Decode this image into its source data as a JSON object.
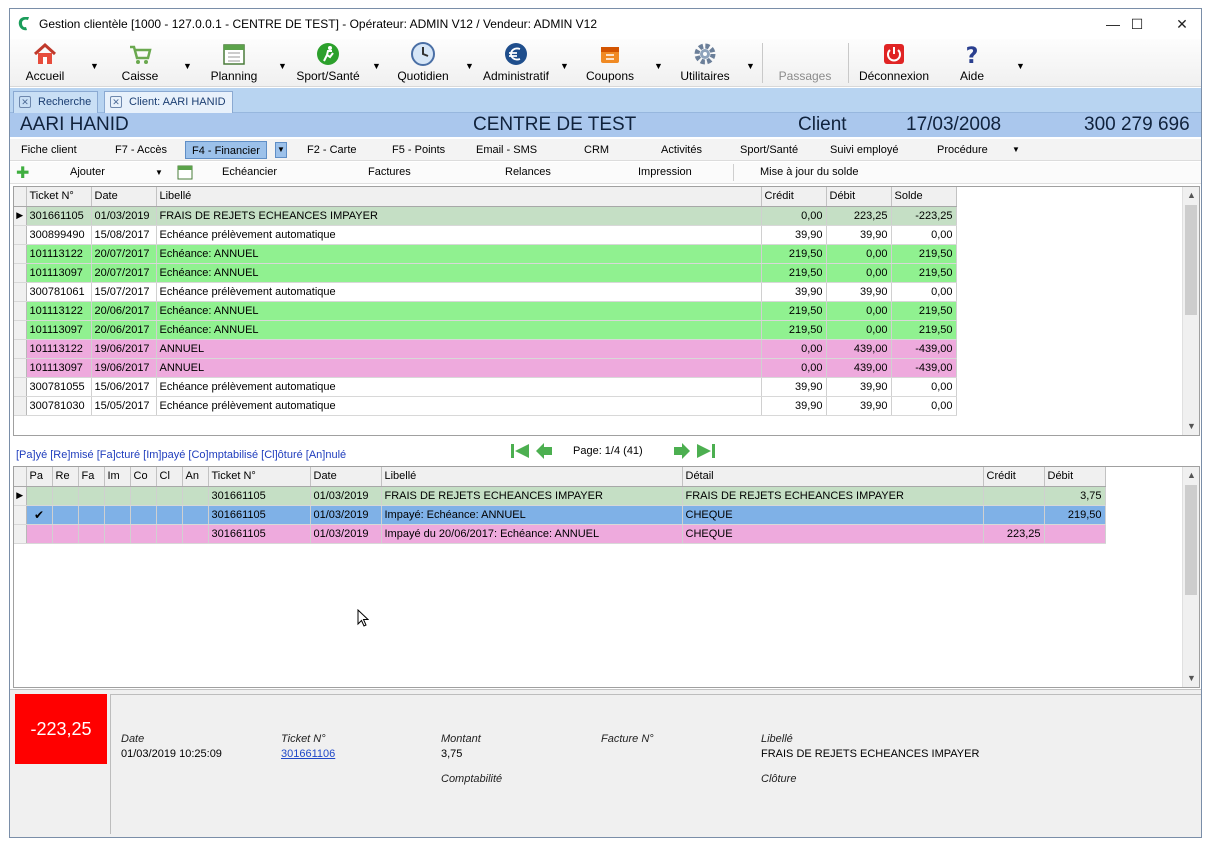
{
  "window": {
    "title": "Gestion clientèle [1000 - 127.0.0.1 - CENTRE DE TEST] - Opérateur: ADMIN V12 / Vendeur: ADMIN V12",
    "minimize": "—",
    "maximize": "☐",
    "close": "✕"
  },
  "toolbar": {
    "accueil": "Accueil",
    "caisse": "Caisse",
    "planning": "Planning",
    "sport": "Sport/Santé",
    "quotidien": "Quotidien",
    "administratif": "Administratif",
    "coupons": "Coupons",
    "utilitaires": "Utilitaires",
    "passages": "Passages",
    "deconnexion": "Déconnexion",
    "aide": "Aide"
  },
  "doc_tabs": {
    "recherche": "Recherche",
    "client": "Client: AARI HANID"
  },
  "header": {
    "name": "AARI HANID",
    "center": "CENTRE DE TEST",
    "type": "Client",
    "date": "17/03/2008",
    "number": "300 279 696"
  },
  "subtabs": {
    "fiche": "Fiche client",
    "acces": "F7 - Accès",
    "financier": "F4 - Financier",
    "carte": "F2 - Carte",
    "points": "F5 - Points",
    "email": "Email - SMS",
    "crm": "CRM",
    "activites": "Activités",
    "sport": "Sport/Santé",
    "suivi": "Suivi employé",
    "procedure": "Procédure"
  },
  "actions": {
    "ajouter": "Ajouter",
    "echeancier": "Echéancier",
    "factures": "Factures",
    "relances": "Relances",
    "impression": "Impression",
    "maj_solde": "Mise à jour du solde"
  },
  "top_grid": {
    "headers": [
      "Ticket N°",
      "Date",
      "Libellé",
      "Crédit",
      "Débit",
      "Solde"
    ],
    "rows": [
      {
        "color": "grey",
        "ticket": "301661105",
        "date": "01/03/2019",
        "libelle": "FRAIS DE REJETS ECHEANCES IMPAYER",
        "credit": "0,00",
        "debit": "223,25",
        "solde": "-223,25"
      },
      {
        "color": "white",
        "ticket": "300899490",
        "date": "15/08/2017",
        "libelle": "Echéance prélèvement automatique",
        "credit": "39,90",
        "debit": "39,90",
        "solde": "0,00"
      },
      {
        "color": "green",
        "ticket": "101113122",
        "date": "20/07/2017",
        "libelle": "Echéance: ANNUEL",
        "credit": "219,50",
        "debit": "0,00",
        "solde": "219,50"
      },
      {
        "color": "green",
        "ticket": "101113097",
        "date": "20/07/2017",
        "libelle": "Echéance: ANNUEL",
        "credit": "219,50",
        "debit": "0,00",
        "solde": "219,50"
      },
      {
        "color": "white",
        "ticket": "300781061",
        "date": "15/07/2017",
        "libelle": "Echéance prélèvement automatique",
        "credit": "39,90",
        "debit": "39,90",
        "solde": "0,00"
      },
      {
        "color": "green",
        "ticket": "101113122",
        "date": "20/06/2017",
        "libelle": "Echéance: ANNUEL",
        "credit": "219,50",
        "debit": "0,00",
        "solde": "219,50"
      },
      {
        "color": "green",
        "ticket": "101113097",
        "date": "20/06/2017",
        "libelle": "Echéance: ANNUEL",
        "credit": "219,50",
        "debit": "0,00",
        "solde": "219,50"
      },
      {
        "color": "pink",
        "ticket": "101113122",
        "date": "19/06/2017",
        "libelle": "ANNUEL",
        "credit": "0,00",
        "debit": "439,00",
        "solde": "-439,00"
      },
      {
        "color": "pink",
        "ticket": "101113097",
        "date": "19/06/2017",
        "libelle": "ANNUEL",
        "credit": "0,00",
        "debit": "439,00",
        "solde": "-439,00"
      },
      {
        "color": "white",
        "ticket": "300781055",
        "date": "15/06/2017",
        "libelle": "Echéance prélèvement automatique",
        "credit": "39,90",
        "debit": "39,90",
        "solde": "0,00"
      },
      {
        "color": "white",
        "ticket": "300781030",
        "date": "15/05/2017",
        "libelle": "Echéance prélèvement automatique",
        "credit": "39,90",
        "debit": "39,90",
        "solde": "0,00"
      }
    ]
  },
  "legend": "[Pa]yé [Re]misé [Fa]cturé [Im]payé [Co]mptabilisé [Cl]ôturé [An]nulé",
  "pager": "Page: 1/4 (41)",
  "bottom_grid": {
    "headers": [
      "Pa",
      "Re",
      "Fa",
      "Im",
      "Co",
      "Cl",
      "An",
      "Ticket N°",
      "Date",
      "Libellé",
      "Détail",
      "Crédit",
      "Débit"
    ],
    "rows": [
      {
        "color": "grey",
        "pa": "",
        "ticket": "301661105",
        "date": "01/03/2019",
        "libelle": "FRAIS DE REJETS ECHEANCES IMPAYER",
        "detail": "FRAIS DE REJETS ECHEANCES IMPAYER",
        "credit": "",
        "debit": "3,75"
      },
      {
        "color": "blue",
        "pa": "✔",
        "ticket": "301661105",
        "date": "01/03/2019",
        "libelle": "Impayé: Echéance: ANNUEL",
        "detail": "CHEQUE",
        "credit": "",
        "debit": "219,50"
      },
      {
        "color": "pink",
        "pa": "",
        "ticket": "301661105",
        "date": "01/03/2019",
        "libelle": "Impayé du 20/06/2017: Echéance: ANNUEL",
        "detail": "CHEQUE",
        "credit": "223,25",
        "debit": ""
      }
    ]
  },
  "footer": {
    "balance": "-223,25",
    "date_label": "Date",
    "date_value": "01/03/2019 10:25:09",
    "ticket_label": "Ticket N°",
    "ticket_value": "301661106",
    "montant_label": "Montant",
    "montant_value": "3,75",
    "facture_label": "Facture N°",
    "libelle_label": "Libellé",
    "libelle_value": "FRAIS DE REJETS ECHEANCES IMPAYER",
    "comptabilite_label": "Comptabilité",
    "cloture_label": "Clôture"
  },
  "colors": {
    "grey": "#c5dfc5",
    "green": "#90f190",
    "pink": "#eeaadd",
    "blue": "#7fb1e7",
    "balance_bg": "#ff0000"
  }
}
